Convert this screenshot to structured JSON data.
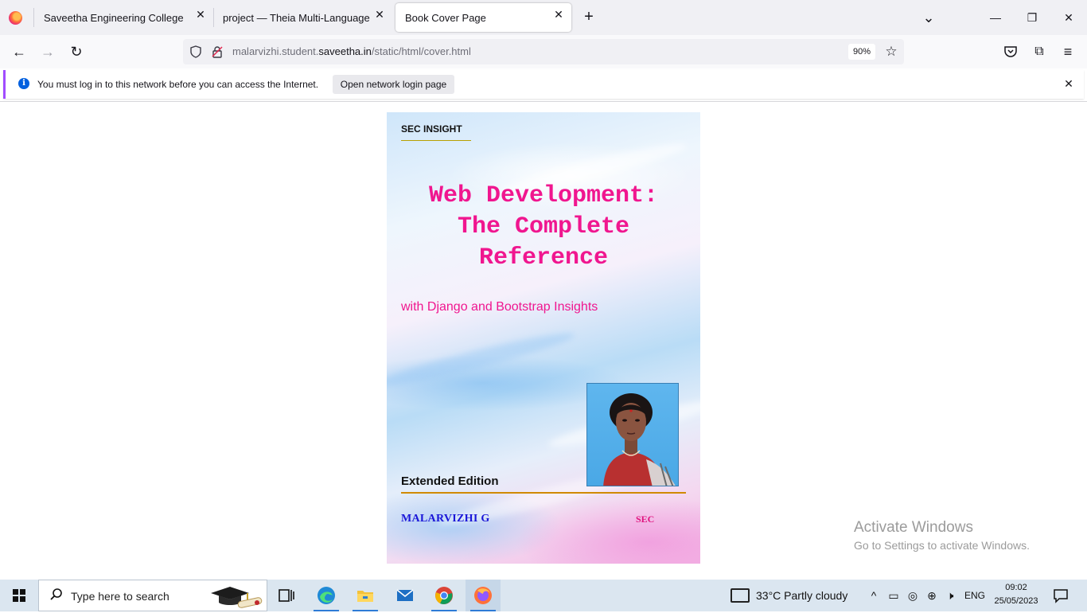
{
  "browser": {
    "tabs": [
      {
        "label": "Saveetha Engineering College",
        "active": false
      },
      {
        "label": "project — Theia Multi-Language Ex",
        "active": false
      },
      {
        "label": "Book Cover Page",
        "active": true
      }
    ],
    "close_glyph": "✕",
    "new_tab_glyph": "+",
    "list_tabs_glyph": "⌄",
    "window_controls": {
      "minimize": "—",
      "restore": "❐",
      "close": "✕"
    }
  },
  "navbar": {
    "back_glyph": "←",
    "forward_glyph": "→",
    "reload_glyph": "↻",
    "url_prefix": "malarvizhi.student.",
    "url_domain": "saveetha.in",
    "url_path": "/static/html/cover.html",
    "zoom": "90%",
    "star_glyph": "☆",
    "pocket_glyph": "◡",
    "extensions_glyph": "⧉",
    "menu_glyph": "≡"
  },
  "notification": {
    "message": "You must log in to this network before you can access the Internet.",
    "button_label": "Open network login page",
    "info_glyph": "i",
    "close_glyph": "✕"
  },
  "cover": {
    "series": "SEC INSIGHT",
    "title_lines": [
      "Web Development:",
      "The Complete",
      "Reference"
    ],
    "subtitle": "with Django and Bootstrap Insights",
    "edition": "Extended Edition",
    "author": "MALARVIZHI G",
    "publisher": "SEC",
    "colors": {
      "title": "#f0168f",
      "author": "#1a16d8",
      "rule": "#d08a00"
    }
  },
  "watermark": {
    "title": "Activate Windows",
    "subtitle": "Go to Settings to activate Windows."
  },
  "taskbar": {
    "search_placeholder": "Type here to search",
    "search_glyph": "⚲",
    "apps": [
      {
        "name": "task-view",
        "running": false
      },
      {
        "name": "edge",
        "running": true
      },
      {
        "name": "file-explorer",
        "running": true
      },
      {
        "name": "mail",
        "running": false
      },
      {
        "name": "chrome",
        "running": true
      },
      {
        "name": "firefox",
        "running": true
      }
    ],
    "weather": "33°C  Partly cloudy",
    "tray_glyphs": {
      "chevron": "^",
      "battery": "▭",
      "meet": "◎",
      "network": "⊕",
      "volume": "🕨"
    },
    "language": "ENG",
    "time": "09:02",
    "date": "25/05/2023"
  }
}
